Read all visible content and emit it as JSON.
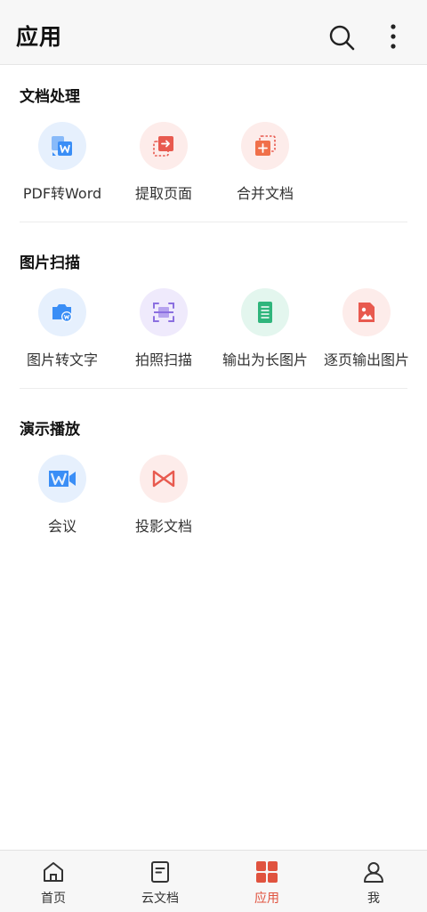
{
  "header": {
    "title": "应用",
    "search_icon": "search-icon",
    "more_icon": "more-vertical-icon"
  },
  "sections": [
    {
      "title": "文档处理",
      "items": [
        {
          "label": "PDF转Word",
          "icon": "pdf-to-word-icon"
        },
        {
          "label": "提取页面",
          "icon": "extract-page-icon"
        },
        {
          "label": "合并文档",
          "icon": "merge-document-icon"
        }
      ]
    },
    {
      "title": "图片扫描",
      "items": [
        {
          "label": "图片转文字",
          "icon": "image-to-text-icon"
        },
        {
          "label": "拍照扫描",
          "icon": "photo-scan-icon"
        },
        {
          "label": "输出为长图片",
          "icon": "long-image-icon"
        },
        {
          "label": "逐页输出图片",
          "icon": "page-image-icon"
        }
      ]
    },
    {
      "title": "演示播放",
      "items": [
        {
          "label": "会议",
          "icon": "meeting-icon"
        },
        {
          "label": "投影文档",
          "icon": "projection-icon"
        }
      ]
    }
  ],
  "tabbar": [
    {
      "label": "首页",
      "icon": "home-icon",
      "active": false
    },
    {
      "label": "云文档",
      "icon": "cloud-document-icon",
      "active": false
    },
    {
      "label": "应用",
      "icon": "apps-grid-icon",
      "active": true
    },
    {
      "label": "我",
      "icon": "profile-icon",
      "active": false
    }
  ],
  "colors": {
    "accent": "#e0533f",
    "blue": "#3a8ef6",
    "red": "#e85a4f",
    "purple": "#8b6fe0",
    "green": "#2fb57c"
  }
}
